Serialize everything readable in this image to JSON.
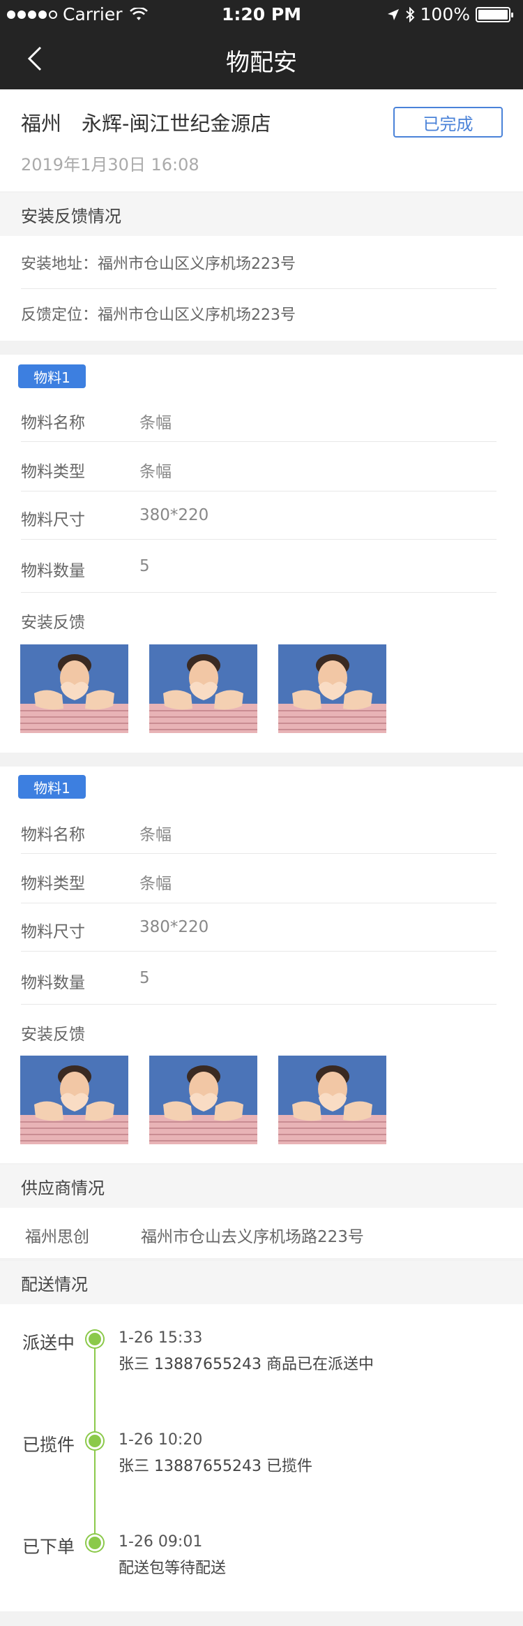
{
  "status_bar": {
    "carrier": "Carrier",
    "time": "1:20 PM",
    "battery": "100%"
  },
  "nav": {
    "title": "物配安"
  },
  "order": {
    "store": "福州　永辉-闽江世纪金源店",
    "status": "已完成",
    "datetime": "2019年1月30日 16:08"
  },
  "install_section": {
    "title": "安装反馈情况",
    "address": "安装地址：福州市仓山区义序机场223号",
    "location": "反馈定位：福州市仓山区义序机场223号"
  },
  "materials": [
    {
      "badge": "物料1",
      "fields": [
        {
          "label": "物料名称",
          "value": "条幅"
        },
        {
          "label": "物料类型",
          "value": "条幅"
        },
        {
          "label": "物料尺寸",
          "value": "380*220"
        },
        {
          "label": "物料数量",
          "value": "5"
        }
      ],
      "feedback_label": "安装反馈"
    },
    {
      "badge": "物料1",
      "fields": [
        {
          "label": "物料名称",
          "value": "条幅"
        },
        {
          "label": "物料类型",
          "value": "条幅"
        },
        {
          "label": "物料尺寸",
          "value": "380*220"
        },
        {
          "label": "物料数量",
          "value": "5"
        }
      ],
      "feedback_label": "安装反馈"
    }
  ],
  "supplier_section": {
    "title": "供应商情况",
    "name": "福州思创",
    "address": "福州市仓山去义序机场路223号"
  },
  "delivery_section": {
    "title": "配送情况",
    "steps": [
      {
        "label": "派送中",
        "time": "1-26  15:33",
        "desc": "张三 13887655243 商品已在派送中"
      },
      {
        "label": "已揽件",
        "time": "1-26  10:20",
        "desc": "张三 13887655243 已揽件"
      },
      {
        "label": "已下单",
        "time": "1-26  09:01",
        "desc": "配送包等待配送"
      }
    ]
  },
  "colors": {
    "accent": "#3d7fe0",
    "timeline": "#8bc94a",
    "header": "#242424"
  }
}
